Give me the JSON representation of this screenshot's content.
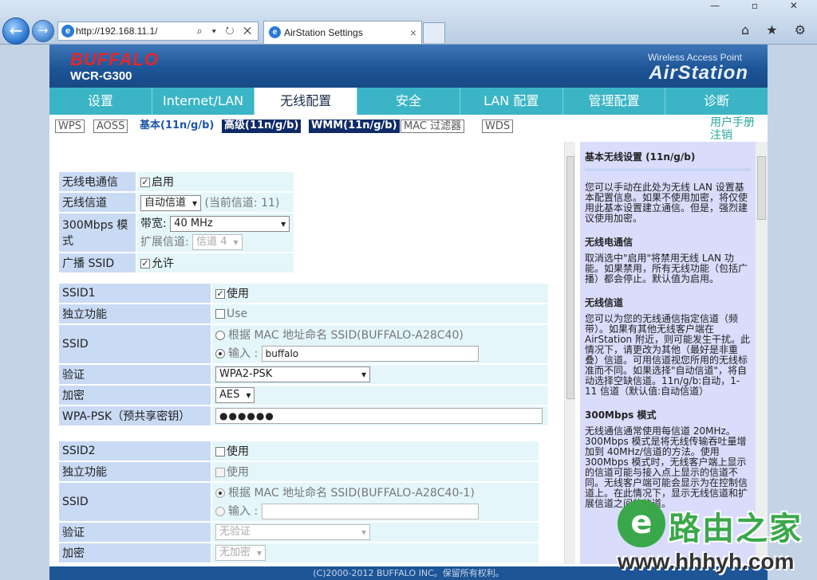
{
  "browser": {
    "back": "←",
    "forward": "→",
    "address": "http://192.168.11.1/",
    "address_icons": "⌕ ▾ ↻ ✕",
    "tab_title": "AirStation Settings",
    "tab_close": "×",
    "window_controls": "— ▫ ✕",
    "tool_icons": "⌂ ★ ⚙"
  },
  "header": {
    "brand": "BUFFALO",
    "model": "WCR-G300",
    "wap": "Wireless Access Point",
    "airstation": "AirStation"
  },
  "main_nav": [
    "设置",
    "Internet/LAN",
    "无线配置",
    "安全",
    "LAN 配置",
    "管理配置",
    "诊断"
  ],
  "main_nav_active": 2,
  "sub_nav": {
    "wps": "WPS",
    "aoss": "AOSS",
    "basic": "基本(11n/g/b)",
    "advanced": "高级(11n/g/b)",
    "wmm": "WMM(11n/g/b)",
    "mac": "MAC 过滤器",
    "wds": "WDS",
    "manual": "用户手册",
    "logout": "注销"
  },
  "radio": {
    "wireless_label": "无线电通信",
    "wireless_value": "启用",
    "channel_label": "无线信道",
    "channel_select": "自动信道",
    "current_channel": "(当前信道: 11)",
    "mode_label": "300Mbps 模式",
    "bandwidth_label": "带宽:",
    "bandwidth_value": "40 MHz",
    "ext_channel_label": "扩展信道:",
    "ext_channel_value": "信道 4",
    "broadcast_label": "广播 SSID",
    "broadcast_value": "允许"
  },
  "ssid1": {
    "title": "SSID1",
    "use": "使用",
    "isolation_label": "独立功能",
    "isolation_value": "Use",
    "ssid_label": "SSID",
    "by_mac": "根据 MAC 地址命名 SSID(BUFFALO-A28C40)",
    "input_label": "输入 :",
    "ssid_value": "buffalo",
    "auth_label": "验证",
    "auth_value": "WPA2-PSK",
    "enc_label": "加密",
    "enc_value": "AES",
    "psk_label": "WPA-PSK（预共享密钥）",
    "psk_value": "●●●●●●"
  },
  "ssid2": {
    "title": "SSID2",
    "use": "使用",
    "isolation_label": "独立功能",
    "isolation_value": "使用",
    "ssid_label": "SSID",
    "by_mac": "根据 MAC 地址命名 SSID(BUFFALO-A28C40-1)",
    "input_label": "输入 :",
    "auth_label": "验证",
    "auth_value": "无验证",
    "enc_label": "加密",
    "enc_value": "无加密"
  },
  "help": {
    "title": "基本无线设置 (11n/g/b)",
    "intro": "您可以手动在此处为无线 LAN 设置基本配置信息。如果不使用加密，将仅使用此基本设置建立通信。但是，强烈建议使用加密。",
    "s1_title": "无线电通信",
    "s1_text": "取消选中\"启用\"将禁用无线 LAN 功能。如果禁用，所有无线功能（包括广播）都会停止。默认值为启用。",
    "s2_title": "无线信道",
    "s2_text": "您可以为您的无线通信指定信道（频带）。如果有其他无线客户端在 AirStation 附近，则可能发生干扰。此情况下，请更改为其他（最好是非重叠）信道。可用信道视您所用的无线标准而不同。如果选择\"自动信道\"，将自动选择空缺信道。11n/g/b:自动，1-11 信道（默认值:自动信道）",
    "s3_title": "300Mbps 模式",
    "s3_text": "无线通信通常使用每信道 20MHz。300Mbps 模式是将无线传输吞吐量增加到 40MHz/信道的方法。使用 300Mbps 模式时，无线客户端上显示的信道可能与接入点上显示的信道不同。无线客户端可能会显示为在控制信道上。在此情况下，显示无线信道和扩展信道之间的信道。"
  },
  "footer": "(C)2000-2012 BUFFALO INC。保留所有权利。",
  "watermark": {
    "logo": "e",
    "text": "路由之家",
    "url": "www.hhhyh.com"
  }
}
